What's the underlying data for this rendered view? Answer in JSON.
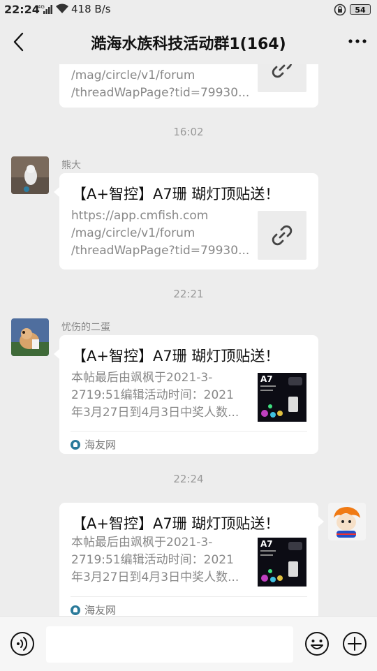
{
  "status_bar": {
    "time": "22:24",
    "signal": "4G",
    "speed": "418 B/s",
    "battery": "54"
  },
  "header": {
    "title": "澔海水族科技活动群1(164)"
  },
  "messages": [
    {
      "type": "link_card_partial",
      "lines": "/mag/circle/v1/forum\n/threadWapPage?tid=79930..."
    },
    {
      "type": "timestamp",
      "text": "16:02"
    },
    {
      "type": "link_card",
      "sender": "熊大",
      "title": "【A+智控】A7珊 瑚灯顶贴送！",
      "desc": "https://app.cmfish.com\n/mag/circle/v1/forum\n/threadWapPage?tid=79930..."
    },
    {
      "type": "timestamp",
      "text": "22:21"
    },
    {
      "type": "article_card",
      "sender": "忧伤的二蛋",
      "title": "【A+智控】A7珊 瑚灯顶贴送！",
      "desc": "本帖最后由飒枫于2021-3-\n2719:51编辑活动时间：2021\n年3月27日到4月3日中奖人数...",
      "source": "海友网"
    },
    {
      "type": "timestamp",
      "text": "22:24"
    },
    {
      "type": "article_card_self",
      "title": "【A+智控】A7珊 瑚灯顶贴送！",
      "desc": "本帖最后由飒枫于2021-3-\n2719:51编辑活动时间：2021\n年3月27日到4月3日中奖人数...",
      "source": "海友网"
    }
  ],
  "thumbnail": {
    "label": "A7"
  },
  "input_bar": {
    "placeholder": ""
  },
  "colors": {
    "background": "#ededed",
    "bubble": "#ffffff",
    "muted_text": "#888888"
  }
}
